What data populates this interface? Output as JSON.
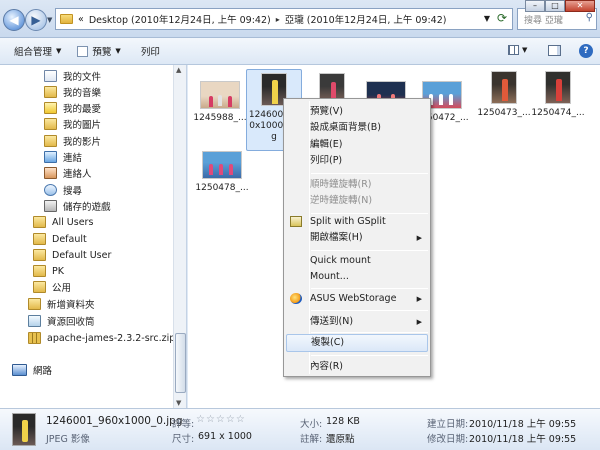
{
  "address": {
    "chevron": "«",
    "crumbs": [
      "Desktop (2010年12月24日, 上午 09:42)",
      "亞瓏 (2010年12月24日, 上午 09:42)"
    ],
    "search_placeholder": "搜尋 亞瓏"
  },
  "toolbar": {
    "organize": "組合管理",
    "preview": "預覽",
    "print": "列印"
  },
  "nav": {
    "items": [
      {
        "label": "我的文件",
        "icon": "folder-doc-icon"
      },
      {
        "label": "我的音樂",
        "icon": "folder-music-icon"
      },
      {
        "label": "我的最愛",
        "icon": "favorites-star-icon"
      },
      {
        "label": "我的圖片",
        "icon": "folder-pictures-icon"
      },
      {
        "label": "我的影片",
        "icon": "folder-videos-icon"
      },
      {
        "label": "連結",
        "icon": "links-icon"
      },
      {
        "label": "連絡人",
        "icon": "contacts-icon"
      },
      {
        "label": "搜尋",
        "icon": "searches-icon"
      },
      {
        "label": "儲存的遊戲",
        "icon": "saved-games-icon"
      },
      {
        "label": "All Users",
        "icon": "folder-icon"
      },
      {
        "label": "Default",
        "icon": "folder-icon"
      },
      {
        "label": "Default User",
        "icon": "folder-icon"
      },
      {
        "label": "PK",
        "icon": "folder-icon"
      },
      {
        "label": "公用",
        "icon": "folder-icon"
      },
      {
        "label": "新增資料夾",
        "icon": "folder-icon"
      },
      {
        "label": "資源回收筒",
        "icon": "recycle-bin-icon"
      },
      {
        "label": "apache-james-2.3.2-src.zip",
        "icon": "zip-icon"
      },
      {
        "label": "網路",
        "icon": "network-icon"
      }
    ]
  },
  "files": [
    {
      "label": "1245988_...",
      "selected": false
    },
    {
      "label": "1246001_9\n0x1000_0.j\ng",
      "selected": true
    },
    {
      "label": "",
      "selected": false
    },
    {
      "label": "",
      "selected": false
    },
    {
      "label": "1250472_...",
      "selected": false
    },
    {
      "label": "1250473_...",
      "selected": false
    },
    {
      "label": "1250474_...",
      "selected": false
    },
    {
      "label": "1250478_...",
      "selected": false
    }
  ],
  "context_menu": {
    "items": [
      "預覽(V)",
      "設成桌面背景(B)",
      "編輯(E)",
      "列印(P)",
      "順時鐘旋轉(R)",
      "逆時鐘旋轉(N)",
      "Split with GSplit",
      "開啟檔案(H)",
      "Quick mount",
      "Mount...",
      "ASUS WebStorage",
      "傳送到(N)",
      "複製(C)",
      "內容(R)"
    ]
  },
  "details": {
    "filename": "1246001_960x1000_0.jpg",
    "filetype": "JPEG 影像",
    "rating_label": "評等:",
    "stars": "☆☆☆☆☆",
    "dims_label": "尺寸:",
    "dims": "691 x 1000",
    "size_label": "大小:",
    "size": "128 KB",
    "tags_label": "註解:",
    "tags": "還原點",
    "created_label": "建立日期:",
    "created": "2010/11/18 上午 09:55",
    "modified_label": "修改日期:",
    "modified": "2010/11/18 上午 09:55"
  }
}
